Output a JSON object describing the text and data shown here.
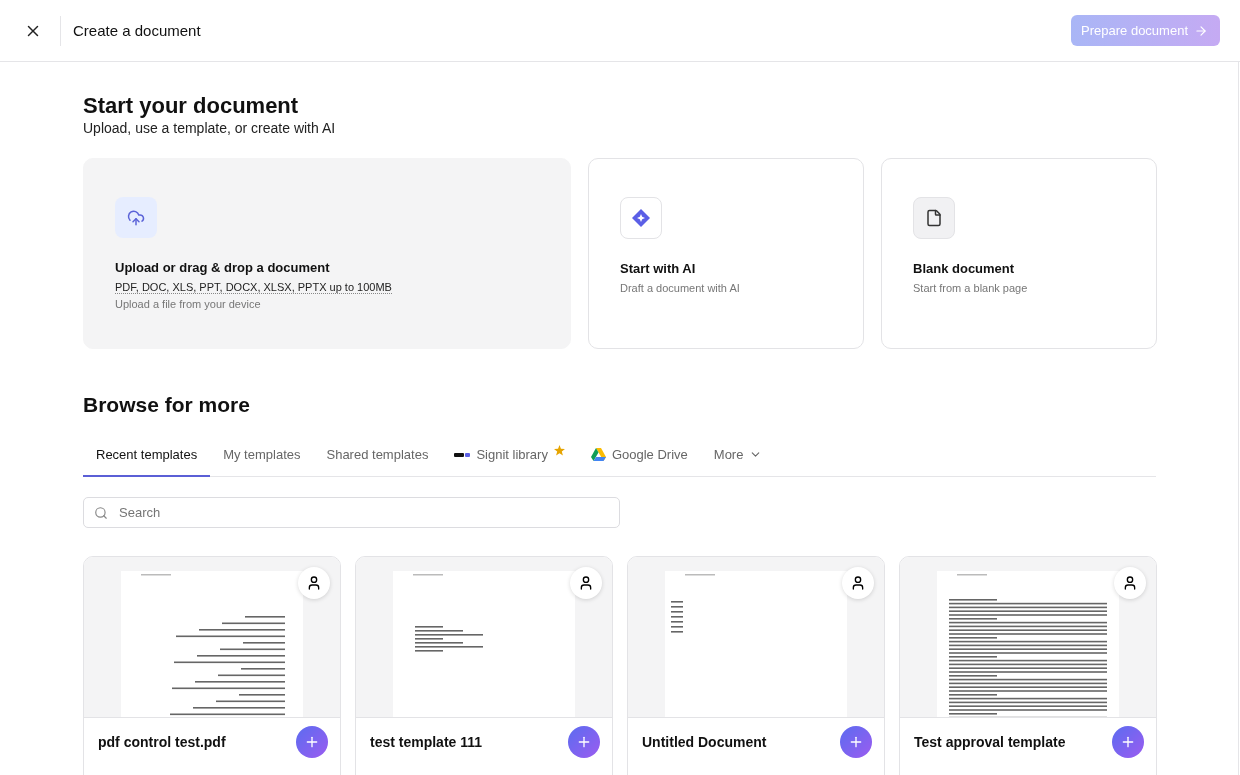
{
  "header": {
    "title": "Create a document",
    "primary_button": {
      "label": "Prepare document",
      "disabled": true
    }
  },
  "intro": {
    "title": "Start your document",
    "subtitle": "Upload, use a template, or create with AI"
  },
  "start_options": [
    {
      "kind": "upload",
      "title": "Upload or drag & drop a document",
      "formats": "PDF, DOC, XLS, PPT, DOCX, XLSX, PPTX up to 100MB",
      "description": "Upload a file from your device"
    },
    {
      "kind": "ai",
      "title": "Start with AI",
      "description": "Draft a document with AI"
    },
    {
      "kind": "blank",
      "title": "Blank document",
      "description": "Start from a blank page"
    }
  ],
  "browse": {
    "title": "Browse for more",
    "tabs": [
      {
        "label": "Recent templates",
        "selected": true
      },
      {
        "label": "My templates",
        "selected": false
      },
      {
        "label": "Shared templates",
        "selected": false
      },
      {
        "label": "Signit library",
        "selected": false,
        "starred": true
      },
      {
        "label": "Google Drive",
        "selected": false
      },
      {
        "label": "More",
        "selected": false,
        "dropdown": true
      }
    ],
    "search": {
      "placeholder": "Search"
    },
    "templates": [
      {
        "name": "pdf control test.pdf"
      },
      {
        "name": "test template 111"
      },
      {
        "name": "Untitled Document"
      },
      {
        "name": "Test approval template"
      }
    ]
  }
}
